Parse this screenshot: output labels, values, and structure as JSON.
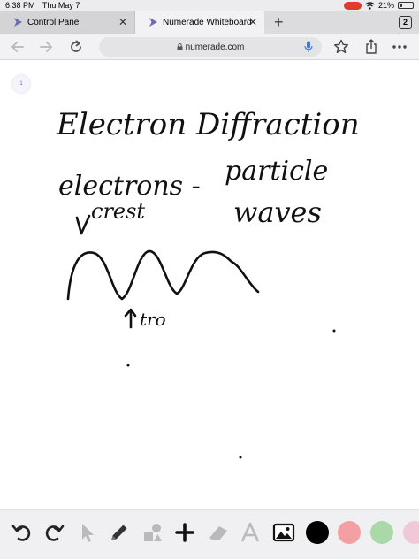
{
  "status_bar": {
    "time": "6:38 PM",
    "date": "Thu May 7",
    "battery": "21%",
    "battery_level": 0.21,
    "icons": [
      "recording-pill",
      "wifi-icon",
      "battery-icon"
    ]
  },
  "tabs": [
    {
      "label": "Control Panel",
      "active": false,
      "icon": "numerade-logo"
    },
    {
      "label": "Numerade Whiteboard",
      "active": true,
      "icon": "numerade-logo"
    }
  ],
  "tab_count": "2",
  "address_bar": {
    "url": "numerade.com"
  },
  "canvas": {
    "page_number": "1",
    "handwriting": {
      "title": "Electron Diffraction",
      "line2_left": "electrons -",
      "line2_right": "particle",
      "line3_left": "crest",
      "line3_right": "waves",
      "trough_label": "tro"
    }
  },
  "whiteboard_toolbar": {
    "tools": [
      "undo-icon",
      "redo-icon",
      "select-pointer-icon",
      "pen-icon",
      "shapes-icon",
      "add-icon",
      "eraser-icon",
      "text-icon",
      "image-icon"
    ],
    "colors": [
      "#000000",
      "#f2a0a4",
      "#a9d8a9",
      "#f0c8d8"
    ],
    "accent": "#6b6bb5"
  }
}
